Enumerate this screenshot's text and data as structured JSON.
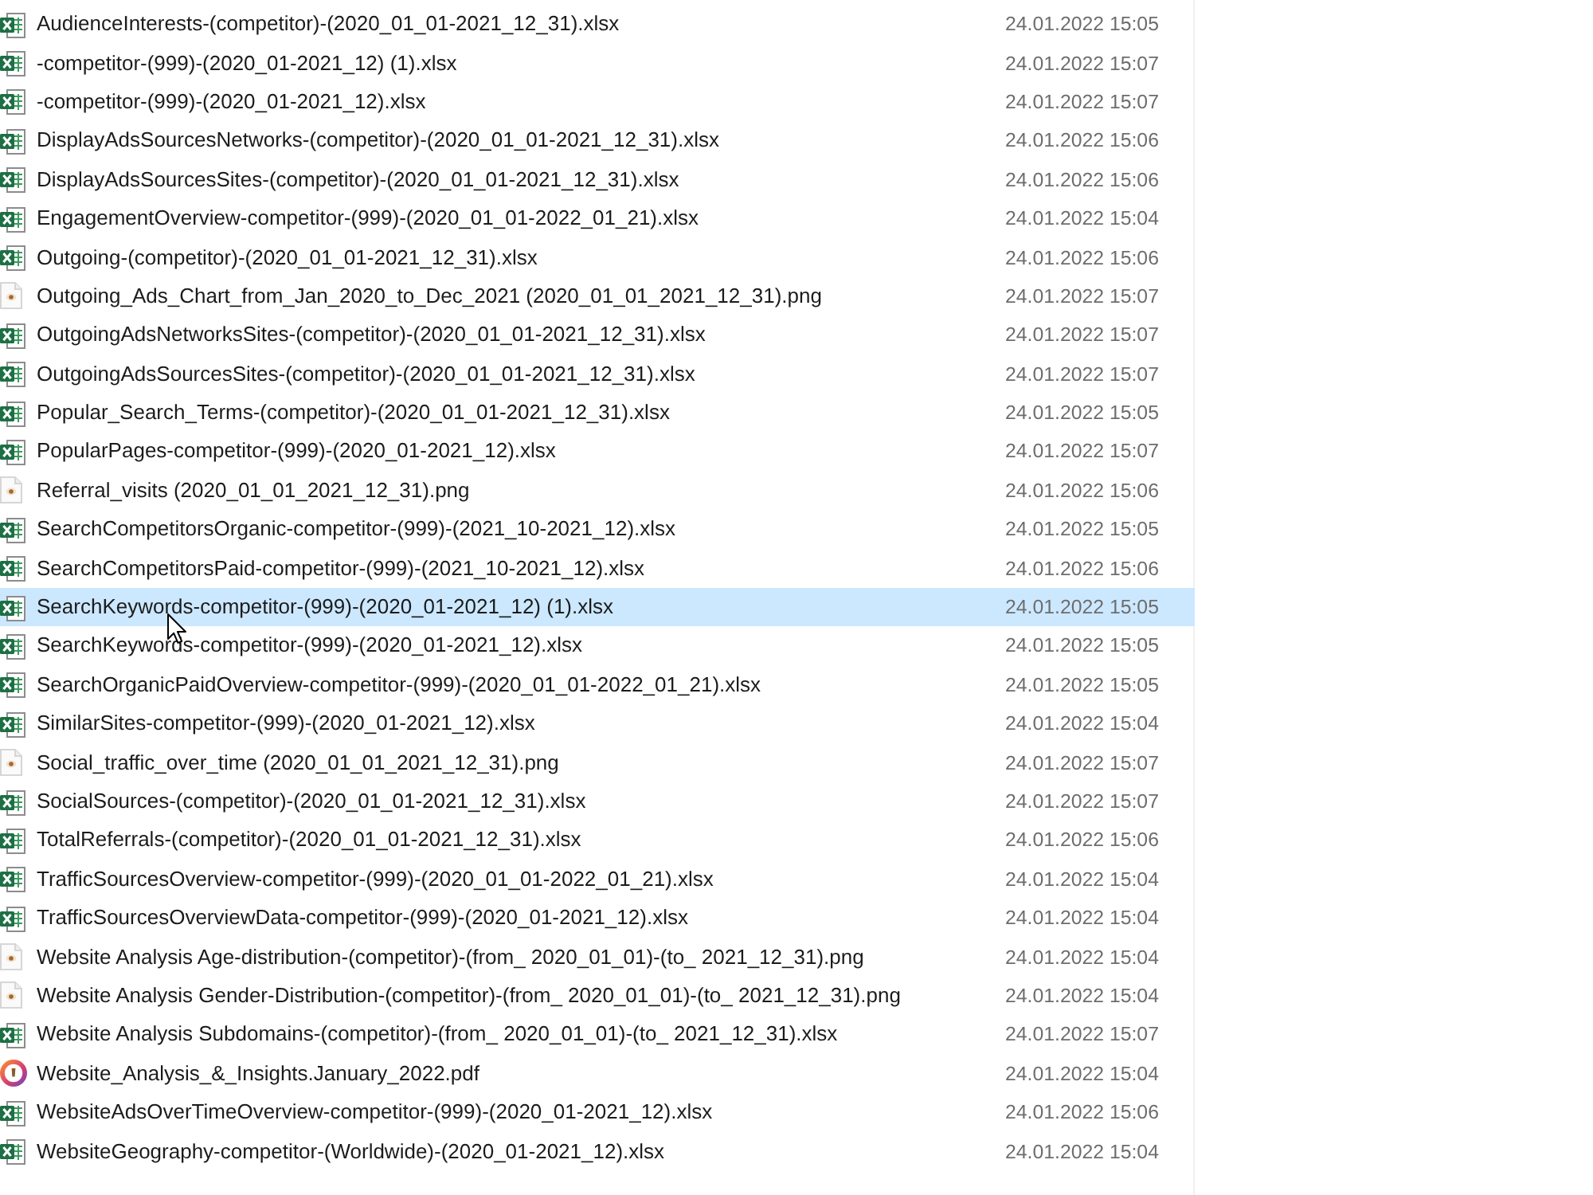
{
  "file_list": {
    "rows": [
      {
        "kind": "xlsx",
        "name": "AudienceInterests-(competitor)-(2020_01_01-2021_12_31).xlsx",
        "modified": "24.01.2022 15:05",
        "selected": false
      },
      {
        "kind": "xlsx",
        "name": "-competitor-(999)-(2020_01-2021_12) (1).xlsx",
        "modified": "24.01.2022 15:07",
        "selected": false
      },
      {
        "kind": "xlsx",
        "name": "-competitor-(999)-(2020_01-2021_12).xlsx",
        "modified": "24.01.2022 15:07",
        "selected": false
      },
      {
        "kind": "xlsx",
        "name": "DisplayAdsSourcesNetworks-(competitor)-(2020_01_01-2021_12_31).xlsx",
        "modified": "24.01.2022 15:06",
        "selected": false
      },
      {
        "kind": "xlsx",
        "name": "DisplayAdsSourcesSites-(competitor)-(2020_01_01-2021_12_31).xlsx",
        "modified": "24.01.2022 15:06",
        "selected": false
      },
      {
        "kind": "xlsx",
        "name": "EngagementOverview-competitor-(999)-(2020_01_01-2022_01_21).xlsx",
        "modified": "24.01.2022 15:04",
        "selected": false
      },
      {
        "kind": "xlsx",
        "name": "Outgoing-(competitor)-(2020_01_01-2021_12_31).xlsx",
        "modified": "24.01.2022 15:06",
        "selected": false
      },
      {
        "kind": "png",
        "name": "Outgoing_Ads_Chart_from_Jan_2020_to_Dec_2021 (2020_01_01_2021_12_31).png",
        "modified": "24.01.2022 15:07",
        "selected": false
      },
      {
        "kind": "xlsx",
        "name": "OutgoingAdsNetworksSites-(competitor)-(2020_01_01-2021_12_31).xlsx",
        "modified": "24.01.2022 15:07",
        "selected": false
      },
      {
        "kind": "xlsx",
        "name": "OutgoingAdsSourcesSites-(competitor)-(2020_01_01-2021_12_31).xlsx",
        "modified": "24.01.2022 15:07",
        "selected": false
      },
      {
        "kind": "xlsx",
        "name": "Popular_Search_Terms-(competitor)-(2020_01_01-2021_12_31).xlsx",
        "modified": "24.01.2022 15:05",
        "selected": false
      },
      {
        "kind": "xlsx",
        "name": "PopularPages-competitor-(999)-(2020_01-2021_12).xlsx",
        "modified": "24.01.2022 15:07",
        "selected": false
      },
      {
        "kind": "png",
        "name": "Referral_visits (2020_01_01_2021_12_31).png",
        "modified": "24.01.2022 15:06",
        "selected": false
      },
      {
        "kind": "xlsx",
        "name": "SearchCompetitorsOrganic-competitor-(999)-(2021_10-2021_12).xlsx",
        "modified": "24.01.2022 15:05",
        "selected": false
      },
      {
        "kind": "xlsx",
        "name": "SearchCompetitorsPaid-competitor-(999)-(2021_10-2021_12).xlsx",
        "modified": "24.01.2022 15:06",
        "selected": false
      },
      {
        "kind": "xlsx",
        "name": "SearchKeywords-competitor-(999)-(2020_01-2021_12) (1).xlsx",
        "modified": "24.01.2022 15:05",
        "selected": true
      },
      {
        "kind": "xlsx",
        "name": "SearchKeywords-competitor-(999)-(2020_01-2021_12).xlsx",
        "modified": "24.01.2022 15:05",
        "selected": false
      },
      {
        "kind": "xlsx",
        "name": "SearchOrganicPaidOverview-competitor-(999)-(2020_01_01-2022_01_21).xlsx",
        "modified": "24.01.2022 15:05",
        "selected": false
      },
      {
        "kind": "xlsx",
        "name": "SimilarSites-competitor-(999)-(2020_01-2021_12).xlsx",
        "modified": "24.01.2022 15:04",
        "selected": false
      },
      {
        "kind": "png",
        "name": "Social_traffic_over_time (2020_01_01_2021_12_31).png",
        "modified": "24.01.2022 15:07",
        "selected": false
      },
      {
        "kind": "xlsx",
        "name": "SocialSources-(competitor)-(2020_01_01-2021_12_31).xlsx",
        "modified": "24.01.2022 15:07",
        "selected": false
      },
      {
        "kind": "xlsx",
        "name": "TotalReferrals-(competitor)-(2020_01_01-2021_12_31).xlsx",
        "modified": "24.01.2022 15:06",
        "selected": false
      },
      {
        "kind": "xlsx",
        "name": "TrafficSourcesOverview-competitor-(999)-(2020_01_01-2022_01_21).xlsx",
        "modified": "24.01.2022 15:04",
        "selected": false
      },
      {
        "kind": "xlsx",
        "name": "TrafficSourcesOverviewData-competitor-(999)-(2020_01-2021_12).xlsx",
        "modified": "24.01.2022 15:04",
        "selected": false
      },
      {
        "kind": "png",
        "name": "Website Analysis Age-distribution-(competitor)-(from_ 2020_01_01)-(to_ 2021_12_31).png",
        "modified": "24.01.2022 15:04",
        "selected": false
      },
      {
        "kind": "png",
        "name": "Website Analysis Gender-Distribution-(competitor)-(from_ 2020_01_01)-(to_ 2021_12_31).png",
        "modified": "24.01.2022 15:04",
        "selected": false
      },
      {
        "kind": "xlsx",
        "name": "Website Analysis Subdomains-(competitor)-(from_ 2020_01_01)-(to_ 2021_12_31).xlsx",
        "modified": "24.01.2022 15:07",
        "selected": false
      },
      {
        "kind": "pdf",
        "name": "Website_Analysis_&_Insights.January_2022.pdf",
        "modified": "24.01.2022 15:04",
        "selected": false
      },
      {
        "kind": "xlsx",
        "name": "WebsiteAdsOverTimeOverview-competitor-(999)-(2020_01-2021_12).xlsx",
        "modified": "24.01.2022 15:06",
        "selected": false
      },
      {
        "kind": "xlsx",
        "name": "WebsiteGeography-competitor-(Worldwide)-(2020_01-2021_12).xlsx",
        "modified": "24.01.2022 15:04",
        "selected": false
      }
    ]
  }
}
